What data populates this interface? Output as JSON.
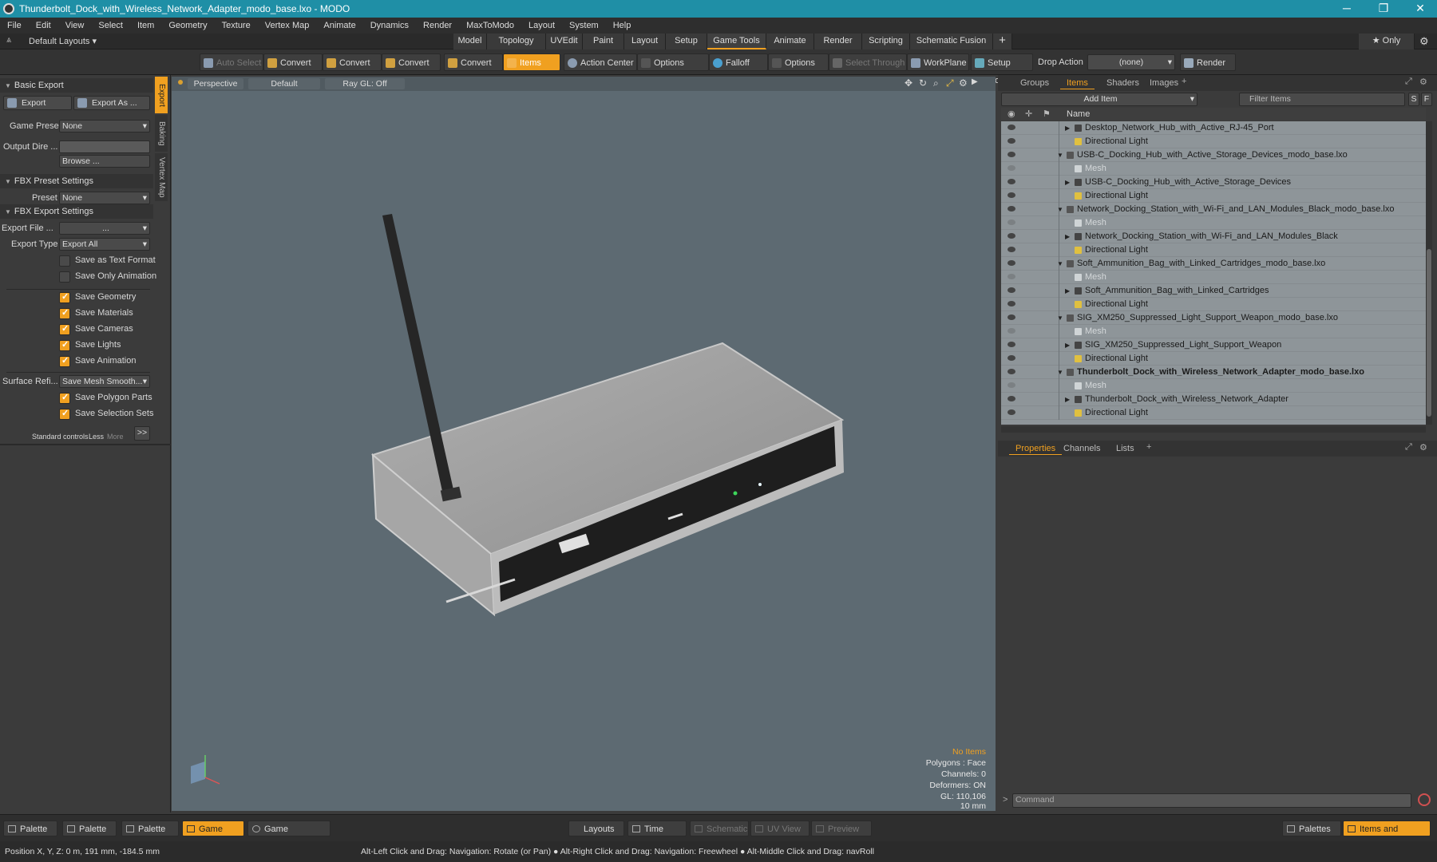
{
  "window": {
    "title": "Thunderbolt_Dock_with_Wireless_Network_Adapter_modo_base.lxo - MODO"
  },
  "menu": [
    "File",
    "Edit",
    "View",
    "Select",
    "Item",
    "Geometry",
    "Texture",
    "Vertex Map",
    "Animate",
    "Dynamics",
    "Render",
    "MaxToModo",
    "Layout",
    "System",
    "Help"
  ],
  "layoutbar": {
    "default_layouts": "Default Layouts ▾",
    "tabs": [
      "Model",
      "Topology",
      "UVEdit",
      "Paint",
      "Layout",
      "Setup",
      "Game Tools",
      "Animate",
      "Render",
      "Scripting",
      "Schematic Fusion"
    ],
    "add": "+",
    "only": "★ Only"
  },
  "toolbar": {
    "auto_select": "Auto Select",
    "convert1": "Convert",
    "convert2": "Convert",
    "convert3": "Convert",
    "convert4": "Convert",
    "items": "Items",
    "action_center": "Action Center",
    "options1": "Options",
    "falloff": "Falloff",
    "options2": "Options",
    "select_through": "Select Through",
    "workplane": "WorkPlane",
    "setup_mode": "Setup Mode",
    "drop_action": "Drop Action",
    "drop_value": "(none)",
    "render": "Render ..."
  },
  "left": {
    "basic_export": "Basic Export",
    "export": "Export",
    "export_as": "Export As ...",
    "game_preset_label": "Game Preset",
    "game_preset_value": "None",
    "output_dir_label": "Output Dire ...",
    "output_dir_value": "",
    "browse": "Browse ...",
    "fbx_preset": "FBX Preset Settings",
    "preset_label": "Preset",
    "preset_value": "None",
    "fbx_export": "FBX Export Settings",
    "export_file_label": "Export File ...",
    "export_file_value": "...",
    "export_type_label": "Export Type",
    "export_type_value": "Export All",
    "opts": [
      {
        "label": "Save as Text Format",
        "on": false
      },
      {
        "label": "Save Only Animation",
        "on": false
      }
    ],
    "opts2": [
      {
        "label": "Save Geometry",
        "on": true
      },
      {
        "label": "Save Materials",
        "on": true
      },
      {
        "label": "Save Cameras",
        "on": true
      },
      {
        "label": "Save Lights",
        "on": true
      },
      {
        "label": "Save Animation",
        "on": true
      }
    ],
    "surface_label": "Surface Refi...",
    "surface_value": "Save Mesh Smooth...",
    "opts3": [
      {
        "label": "Save Polygon Parts",
        "on": true
      },
      {
        "label": "Save Selection Sets",
        "on": true
      }
    ],
    "standard_controls": "Standard controls",
    "less": "Less",
    "more": "More",
    "expand": ">>",
    "sidetabs": [
      "Export",
      "Baking",
      "Vertex Map"
    ]
  },
  "viewport": {
    "view": "Perspective",
    "shading": "Default",
    "raygl": "Ray GL: Off",
    "info": {
      "no_items": "No Items",
      "polygons": "Polygons : Face",
      "channels": "Channels: 0",
      "deformers": "Deformers: ON",
      "gl": "GL: 110,106",
      "scale": "10 mm"
    }
  },
  "right": {
    "tabs": [
      "Groups",
      "Items",
      "Shaders",
      "Images"
    ],
    "add_item": "Add Item",
    "filter": "Filter Items",
    "s": "S",
    "f": "F",
    "name_col": "Name",
    "rows": [
      {
        "text": "Desktop_Network_Hub_with_Active_RJ-45_Port",
        "indent": 2,
        "type": "item"
      },
      {
        "text": "Directional Light",
        "indent": 2,
        "type": "light"
      },
      {
        "text": "USB-C_Docking_Hub_with_Active_Storage_Devices_modo_base.lxo",
        "indent": 1,
        "type": "scene"
      },
      {
        "text": "Mesh",
        "indent": 2,
        "type": "mesh"
      },
      {
        "text": "USB-C_Docking_Hub_with_Active_Storage_Devices",
        "indent": 2,
        "type": "item"
      },
      {
        "text": "Directional Light",
        "indent": 2,
        "type": "light"
      },
      {
        "text": "Network_Docking_Station_with_Wi-Fi_and_LAN_Modules_Black_modo_base.lxo",
        "indent": 1,
        "type": "scene"
      },
      {
        "text": "Mesh",
        "indent": 2,
        "type": "mesh"
      },
      {
        "text": "Network_Docking_Station_with_Wi-Fi_and_LAN_Modules_Black",
        "indent": 2,
        "type": "item"
      },
      {
        "text": "Directional Light",
        "indent": 2,
        "type": "light"
      },
      {
        "text": "Soft_Ammunition_Bag_with_Linked_Cartridges_modo_base.lxo",
        "indent": 1,
        "type": "scene"
      },
      {
        "text": "Mesh",
        "indent": 2,
        "type": "mesh"
      },
      {
        "text": "Soft_Ammunition_Bag_with_Linked_Cartridges",
        "indent": 2,
        "type": "item"
      },
      {
        "text": "Directional Light",
        "indent": 2,
        "type": "light"
      },
      {
        "text": "SIG_XM250_Suppressed_Light_Support_Weapon_modo_base.lxo",
        "indent": 1,
        "type": "scene"
      },
      {
        "text": "Mesh",
        "indent": 2,
        "type": "mesh"
      },
      {
        "text": "SIG_XM250_Suppressed_Light_Support_Weapon",
        "indent": 2,
        "type": "item"
      },
      {
        "text": "Directional Light",
        "indent": 2,
        "type": "light"
      },
      {
        "text": "Thunderbolt_Dock_with_Wireless_Network_Adapter_modo_base.lxo",
        "indent": 1,
        "type": "scene",
        "bold": true
      },
      {
        "text": "Mesh",
        "indent": 2,
        "type": "mesh"
      },
      {
        "text": "Thunderbolt_Dock_with_Wireless_Network_Adapter",
        "indent": 2,
        "type": "item"
      },
      {
        "text": "Directional Light",
        "indent": 2,
        "type": "light"
      }
    ],
    "prop_tabs": [
      "Properties",
      "Channels",
      "Lists"
    ],
    "command": "Command"
  },
  "bottom": {
    "palette1": "Palette",
    "palette2": "Palette",
    "palette3": "Palette",
    "game_tools": "Game Tools",
    "game_nav": "Game Navigation",
    "layouts": "Layouts",
    "time": "Time",
    "schematic": "Schematic",
    "uvview": "UV View",
    "preview": "Preview",
    "palettes": "Palettes",
    "items_shading": "Items and Shading"
  },
  "status": {
    "position": "Position X, Y, Z:   0 m, 191 mm, -184.5 mm",
    "hint": "Alt-Left Click and Drag: Navigation: Rotate (or Pan) ● Alt-Right Click and Drag: Navigation: Freewheel ● Alt-Middle Click and Drag: navRoll"
  },
  "colors": {
    "accent": "#f0a020",
    "titlebar": "#1f8fa6",
    "viewport": "#5d6a72"
  }
}
